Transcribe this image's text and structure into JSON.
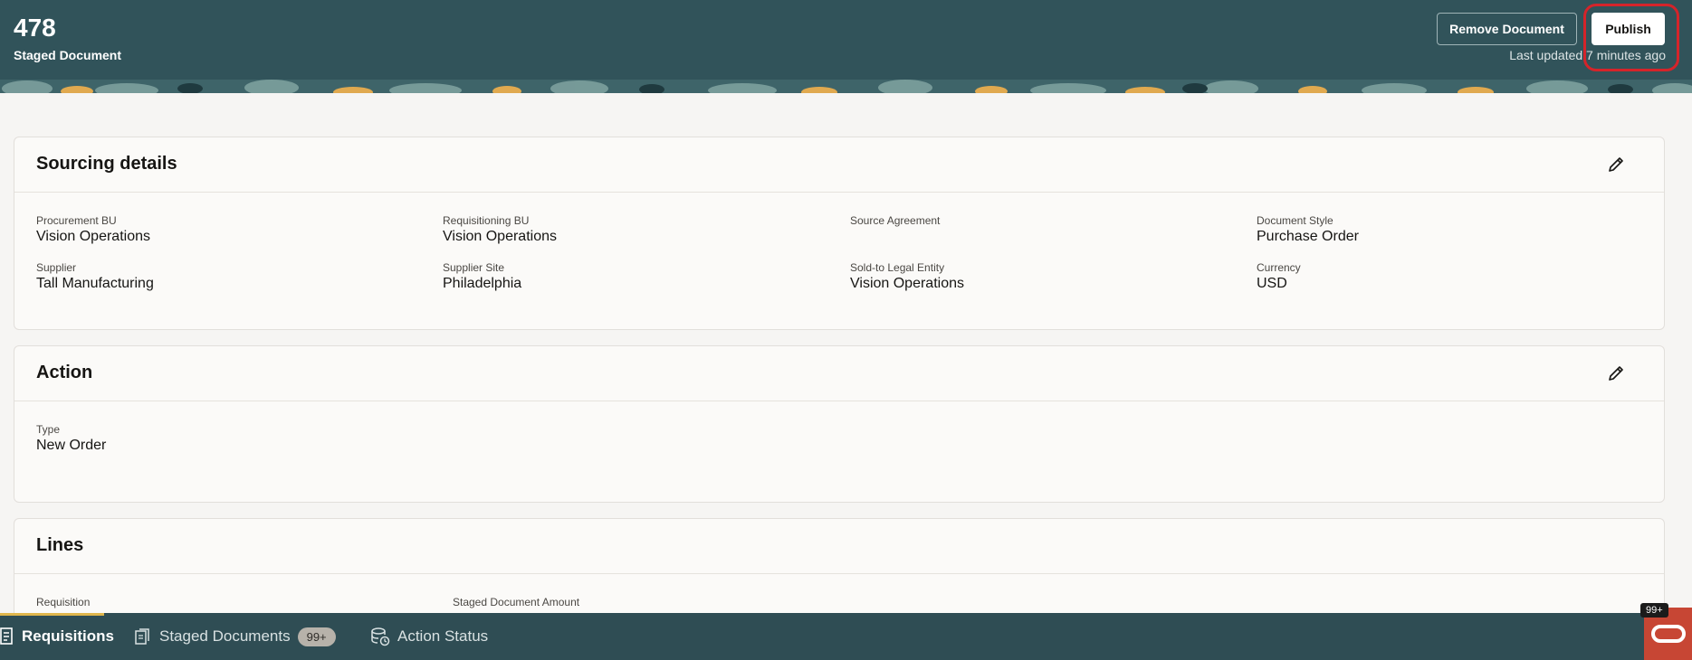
{
  "header": {
    "document_number": "478",
    "document_type": "Staged Document",
    "remove_label": "Remove Document",
    "publish_label": "Publish",
    "last_updated": "Last updated 7 minutes ago"
  },
  "sourcing": {
    "title": "Sourcing details",
    "fields": [
      {
        "label": "Procurement BU",
        "value": "Vision Operations"
      },
      {
        "label": "Requisitioning BU",
        "value": "Vision Operations"
      },
      {
        "label": "Source Agreement",
        "value": ""
      },
      {
        "label": "Document Style",
        "value": "Purchase Order"
      },
      {
        "label": "Supplier",
        "value": "Tall Manufacturing"
      },
      {
        "label": "Supplier Site",
        "value": "Philadelphia"
      },
      {
        "label": "Sold-to Legal Entity",
        "value": "Vision Operations"
      },
      {
        "label": "Currency",
        "value": "USD"
      }
    ]
  },
  "action": {
    "title": "Action",
    "fields": [
      {
        "label": "Type",
        "value": "New Order"
      }
    ]
  },
  "lines": {
    "title": "Lines",
    "fields": [
      {
        "label": "Requisition",
        "value": ""
      },
      {
        "label": "Staged Document Amount",
        "value": ""
      }
    ]
  },
  "bottom_tabs": [
    {
      "label": "Requisitions",
      "icon": "document-list-icon"
    },
    {
      "label": "Staged Documents",
      "icon": "staged-documents-icon",
      "badge": "99+"
    },
    {
      "label": "Action Status",
      "icon": "action-status-icon"
    }
  ],
  "notification_badge": "99+",
  "colors": {
    "header_bg": "#31535a",
    "bottom_bar_bg": "#2f4d54",
    "highlight": "#d5242a",
    "oracle_red": "#c74634"
  }
}
